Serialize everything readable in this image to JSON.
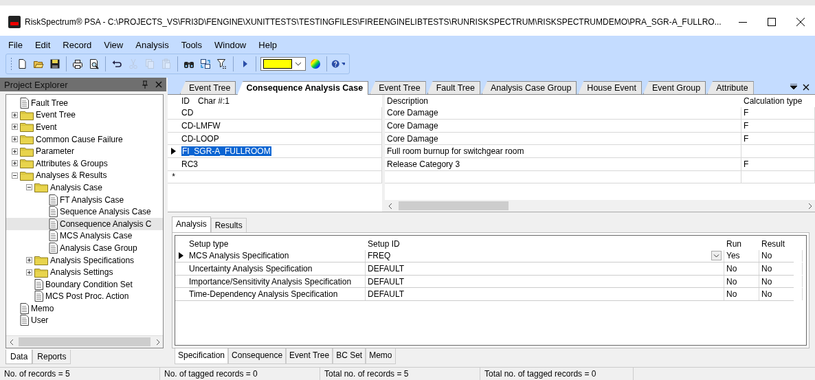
{
  "window": {
    "title": "RiskSpectrum® PSA - C:\\PROJECTS_VS\\FRI3D\\FENGINE\\XUNITTESTS\\TESTINGFILES\\FIREENGINELIBTESTS\\RUNRISKSPECTRUM\\RISKSPECTRUMDEMO\\PRA_SGR-A_FULLRO..."
  },
  "menu": [
    "File",
    "Edit",
    "Record",
    "View",
    "Analysis",
    "Tools",
    "Window",
    "Help"
  ],
  "toolbar": [
    {
      "kind": "new",
      "disabled": false
    },
    {
      "kind": "open",
      "disabled": false
    },
    {
      "kind": "save",
      "disabled": false
    },
    {
      "kind": "sep"
    },
    {
      "kind": "print",
      "disabled": false
    },
    {
      "kind": "preview",
      "disabled": false
    },
    {
      "kind": "sep"
    },
    {
      "kind": "undo",
      "disabled": false
    },
    {
      "kind": "cut",
      "disabled": true
    },
    {
      "kind": "copy",
      "disabled": true
    },
    {
      "kind": "paste",
      "disabled": true
    },
    {
      "kind": "sep"
    },
    {
      "kind": "find",
      "disabled": false
    },
    {
      "kind": "sync",
      "disabled": false
    },
    {
      "kind": "filter",
      "disabled": false
    },
    {
      "kind": "sep"
    },
    {
      "kind": "run",
      "disabled": false
    },
    {
      "kind": "sep"
    },
    {
      "kind": "color-combo",
      "color": "#ffff00"
    },
    {
      "kind": "palette",
      "disabled": false
    },
    {
      "kind": "sep"
    },
    {
      "kind": "help",
      "disabled": false
    }
  ],
  "project_explorer": {
    "title": "Project Explorer",
    "tree": [
      {
        "label": "Fault Tree",
        "kind": "doc",
        "selected": false
      },
      {
        "label": "Event Tree",
        "kind": "folder",
        "expanded": false,
        "selected": false
      },
      {
        "label": "Event",
        "kind": "folder",
        "expanded": false,
        "selected": false
      },
      {
        "label": "Common Cause Failure",
        "kind": "folder",
        "expanded": false,
        "selected": false
      },
      {
        "label": "Parameter",
        "kind": "folder",
        "expanded": false,
        "selected": false
      },
      {
        "label": "Attributes & Groups",
        "kind": "folder",
        "expanded": false,
        "selected": false
      },
      {
        "label": "Analyses & Results",
        "kind": "folder",
        "expanded": true,
        "selected": false,
        "children": [
          {
            "label": "Analysis Case",
            "kind": "folder",
            "expanded": true,
            "selected": false,
            "children": [
              {
                "label": "FT Analysis Case",
                "kind": "doc",
                "selected": false
              },
              {
                "label": "Sequence Analysis Case",
                "kind": "doc",
                "selected": false
              },
              {
                "label": "Consequence Analysis C",
                "kind": "doc",
                "selected": true
              },
              {
                "label": "MCS Analysis Case",
                "kind": "doc",
                "selected": false
              },
              {
                "label": "Analysis Case Group",
                "kind": "doc",
                "selected": false
              }
            ]
          },
          {
            "label": "Analysis Specifications",
            "kind": "folder",
            "expanded": false,
            "selected": false
          },
          {
            "label": "Analysis Settings",
            "kind": "folder",
            "expanded": false,
            "selected": false
          },
          {
            "label": "Boundary Condition Set",
            "kind": "doc",
            "selected": false
          },
          {
            "label": "MCS Post Proc. Action",
            "kind": "doc",
            "selected": false
          }
        ]
      },
      {
        "label": "Memo",
        "kind": "doc",
        "selected": false
      },
      {
        "label": "User",
        "kind": "doc",
        "selected": false
      }
    ],
    "tabs": [
      {
        "label": "Data",
        "selected": true
      },
      {
        "label": "Reports",
        "selected": false
      }
    ]
  },
  "document_tabs": [
    {
      "label": "Event Tree",
      "selected": false
    },
    {
      "label": "Consequence Analysis Case",
      "selected": true
    },
    {
      "label": "Event Tree",
      "selected": false
    },
    {
      "label": "Fault Tree",
      "selected": false
    },
    {
      "label": "Analysis Case Group",
      "selected": false
    },
    {
      "label": "House Event",
      "selected": false
    },
    {
      "label": "Event Group",
      "selected": false
    },
    {
      "label": "Attribute",
      "selected": false
    }
  ],
  "records": {
    "id_columns": [
      "ID",
      "Char #:1"
    ],
    "columns": [
      "Description",
      "Calculation type"
    ],
    "new_row_marker": "*",
    "rows": [
      {
        "id": "CD",
        "description": "Core Damage",
        "calculation_type": "F",
        "selected": false
      },
      {
        "id": "CD-LMFW",
        "description": "Core Damage",
        "calculation_type": "F",
        "selected": false
      },
      {
        "id": "CD-LOOP",
        "description": "Core Damage",
        "calculation_type": "F",
        "selected": false
      },
      {
        "id": "FI_SGR-A_FULLROOM",
        "description": "Full room burnup for switchgear room",
        "selected": true
      },
      {
        "id": "RC3",
        "description": "Release Category 3",
        "calculation_type": "F",
        "selected": false
      }
    ]
  },
  "detail_tabs": [
    {
      "label": "Analysis",
      "selected": true
    },
    {
      "label": "Results",
      "selected": false
    }
  ],
  "setup": {
    "columns": [
      "Setup type",
      "Setup ID",
      "Run",
      "Result"
    ],
    "rows": [
      {
        "setup_type": "MCS Analysis Specification",
        "setup_id": "FREQ",
        "run": "Yes",
        "result": "No",
        "selected": true
      },
      {
        "setup_type": "Uncertainty Analysis Specification",
        "setup_id": "DEFAULT",
        "run": "No",
        "result": "No",
        "selected": false
      },
      {
        "setup_type": "Importance/Sensitivity Analysis Specification",
        "setup_id": "DEFAULT",
        "run": "No",
        "result": "No",
        "selected": false
      },
      {
        "setup_type": "Time-Dependency Analysis Specification",
        "setup_id": "DEFAULT",
        "run": "No",
        "result": "No",
        "selected": false
      }
    ]
  },
  "bottom_tabs": [
    {
      "label": "Specification",
      "selected": true
    },
    {
      "label": "Consequence",
      "selected": false
    },
    {
      "label": "Event Tree",
      "selected": false
    },
    {
      "label": "BC Set",
      "selected": false
    },
    {
      "label": "Memo",
      "selected": false
    }
  ],
  "status_bar": [
    "No. of records = 5",
    "No. of tagged records = 0",
    "Total no. of records = 5",
    "Total no. of tagged records = 0"
  ]
}
